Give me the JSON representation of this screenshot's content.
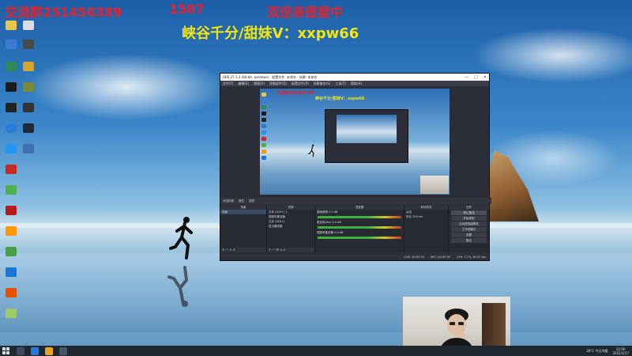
{
  "stream_overlay": {
    "qq_group": "交流群251456389",
    "number": "1587",
    "promo": "双倍亲密度中",
    "sub_promo": "峡谷千分/甜妹V：xxpw66"
  },
  "obs": {
    "window_title": "OBS 27.1.3 (64-bit, windows) - 配置文件: 未命名 - 场景: 未命名",
    "window_controls": [
      "—",
      "□",
      "✕"
    ],
    "menu": [
      "文件(F)",
      "编辑(E)",
      "视图(V)",
      "停靠部件(D)",
      "配置文件(P)",
      "场景集合(S)",
      "工具(T)",
      "帮助(H)"
    ],
    "preview_overlay_red": "交流群251456389",
    "preview_overlay_yellow": "峡谷千分/甜妹V：xxpw66",
    "context_bar": [
      "未选择源",
      "属性",
      "滤镜"
    ],
    "docks": {
      "scenes": {
        "title": "场景",
        "items": [
          "场景"
        ]
      },
      "sources": {
        "title": "来源",
        "items": [
          "文本 (GDI+) 2",
          "视频采集设备",
          "文本 (GDI+)",
          "显示器采集"
        ]
      },
      "mixer": {
        "title": "混音器",
        "tracks": [
          "桌面音频",
          "麦克风/Aux",
          "视频采集设备"
        ],
        "db": [
          "0.0 dB",
          "0.0 dB",
          "0.0 dB"
        ]
      },
      "transitions": {
        "title": "转场特效",
        "type": "淡出",
        "duration_label": "时长",
        "duration": "300 ms"
      },
      "controls": {
        "title": "控件",
        "buttons": [
          "停止推流",
          "开始录制",
          "启动虚拟摄像机",
          "工作室模式",
          "设置",
          "退出"
        ]
      }
    },
    "status": [
      "LIVE: 00:00:00",
      "REC: 00:00:00",
      "CPU: 1.7%, 60.00 fps"
    ]
  },
  "taskbar": {
    "tray_text": "28°C 今日冷暖",
    "time": "22:00",
    "date": "2022/3/17"
  },
  "colors": {
    "overlay_red": "#e8202a",
    "overlay_yellow": "#f2e60a",
    "obs_bg": "#2b2e38"
  }
}
